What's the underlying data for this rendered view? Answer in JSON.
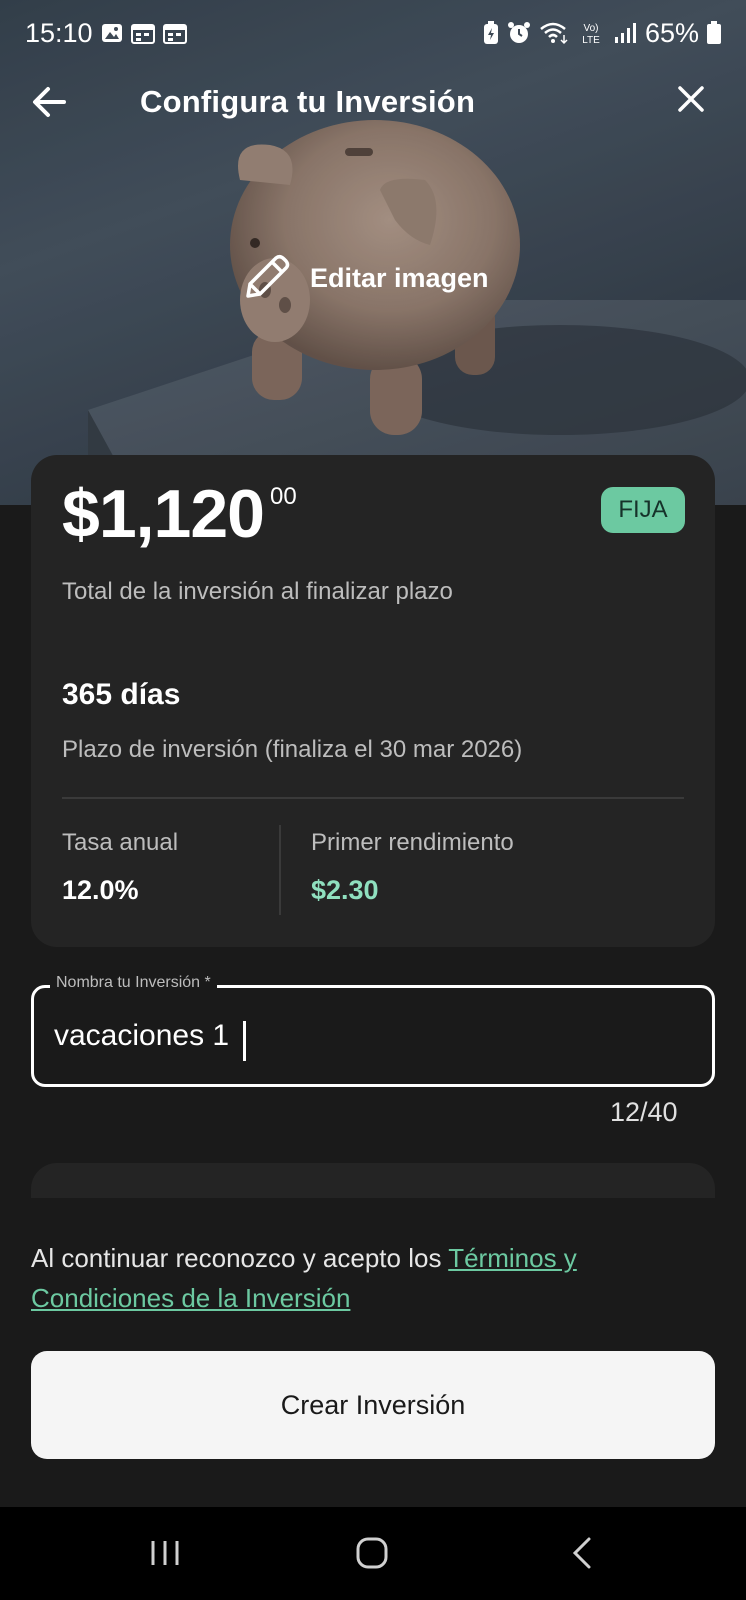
{
  "status_bar": {
    "time": "15:10",
    "battery": "65%",
    "icons_left": [
      "gallery-icon",
      "calendar-icon",
      "calendar-icon"
    ],
    "icons_right": [
      "battery-saver-icon",
      "alarm-icon",
      "wifi-icon",
      "volte-icon",
      "signal-icon",
      "battery-icon"
    ]
  },
  "header": {
    "title": "Configura tu Inversión",
    "back_icon": "arrow-left-icon",
    "close_icon": "close-icon"
  },
  "hero": {
    "edit_label": "Editar imagen",
    "edit_icon": "pencil-icon"
  },
  "summary": {
    "amount": "$1,120",
    "cents": "00",
    "badge": "FIJA",
    "total_label": "Total de la inversión al finalizar plazo",
    "days": "365 días",
    "term_label": "Plazo de inversión (finaliza el 30 mar 2026)",
    "rate_label": "Tasa anual",
    "rate_value": "12.0%",
    "yield_label": "Primer rendimiento",
    "yield_value": "$2.30"
  },
  "name_field": {
    "label": "Nombra tu Inversión *",
    "value": "vacaciones 1",
    "counter": "12/40"
  },
  "terms": {
    "text": "Al continuar reconozco y acepto los ",
    "link": "Términos y Condiciones de la Inversión"
  },
  "cta": {
    "label": "Crear Inversión"
  },
  "colors": {
    "accent": "#6cc9a1",
    "yield": "#8fe0bf",
    "background": "#1a1a1a",
    "card": "#242424"
  },
  "nav_bar": {
    "icons": [
      "recent-apps-icon",
      "home-icon",
      "back-icon"
    ]
  }
}
